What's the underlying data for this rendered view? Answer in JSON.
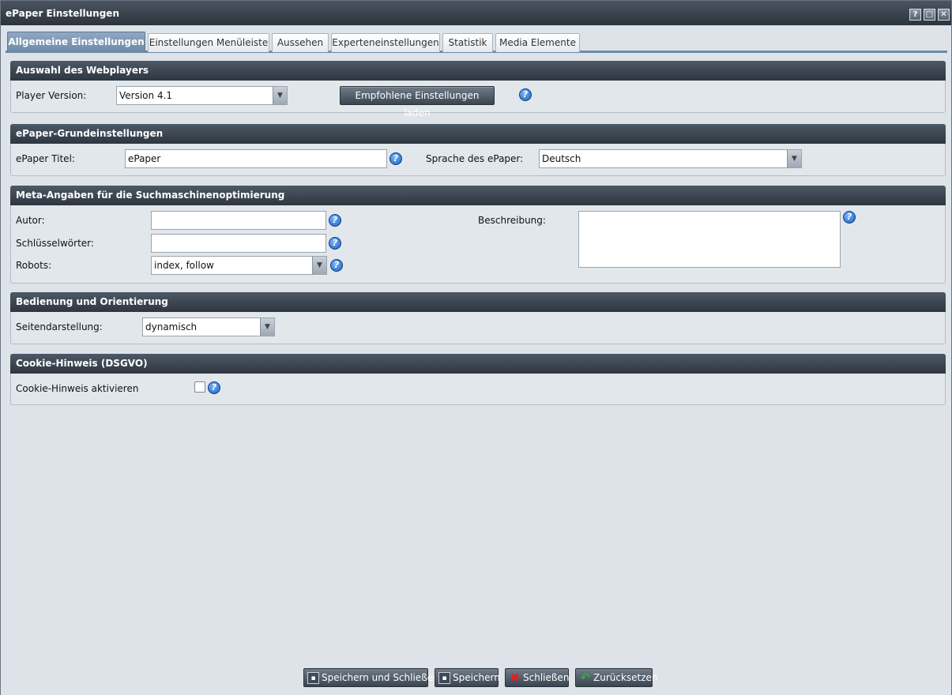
{
  "window": {
    "title": "ePaper Einstellungen",
    "buttons": {
      "help": "?",
      "maximize": "□",
      "close": "✕"
    }
  },
  "tabs": [
    {
      "label": "Allgemeine Einstellungen",
      "active": true
    },
    {
      "label": "Einstellungen Menüleiste",
      "active": false
    },
    {
      "label": "Aussehen",
      "active": false
    },
    {
      "label": "Experteneinstellungen",
      "active": false
    },
    {
      "label": "Statistik",
      "active": false
    },
    {
      "label": "Media Elemente",
      "active": false
    }
  ],
  "webplayer": {
    "header": "Auswahl des Webplayers",
    "player_version_label": "Player Version:",
    "player_version_value": "Version 4.1",
    "load_button": "Empfohlene Einstellungen laden"
  },
  "basic": {
    "header": "ePaper-Grundeinstellungen",
    "title_label": "ePaper Titel:",
    "title_value": "ePaper",
    "language_label": "Sprache des ePaper:",
    "language_value": "Deutsch"
  },
  "meta": {
    "header": "Meta-Angaben für die Suchmaschinenoptimierung",
    "author_label": "Autor:",
    "author_value": "",
    "keywords_label": "Schlüsselwörter:",
    "keywords_value": "",
    "robots_label": "Robots:",
    "robots_value": "index, follow",
    "description_label": "Beschreibung:",
    "description_value": ""
  },
  "navigation": {
    "header": "Bedienung und Orientierung",
    "page_display_label": "Seitendarstellung:",
    "page_display_value": "dynamisch"
  },
  "cookie": {
    "header": "Cookie-Hinweis (DSGVO)",
    "activate_label": "Cookie-Hinweis aktivieren",
    "checked": false
  },
  "footer": {
    "save_close": "Speichern und Schließen",
    "save": "Speichern",
    "close": "Schließen",
    "reset": "Zurücksetzen"
  },
  "colors": {
    "panel_header": "#3a4450",
    "active_tab": "#7b96b1",
    "background": "#dde3e8"
  }
}
